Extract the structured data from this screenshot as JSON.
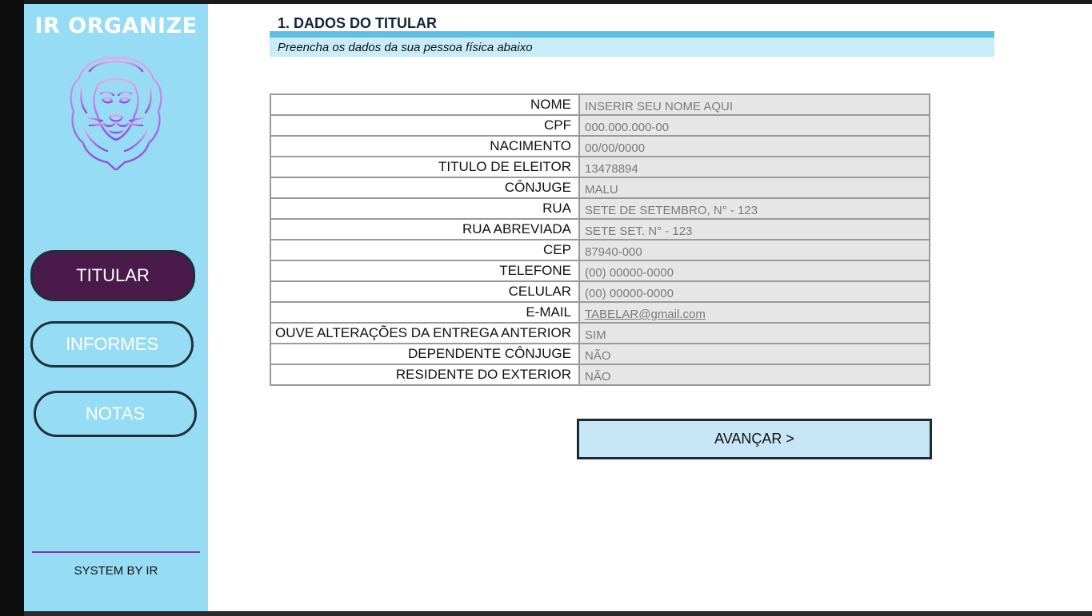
{
  "sidebar": {
    "brand": "IR ORGANIZE",
    "nav": [
      {
        "label": "TITULAR",
        "active": true
      },
      {
        "label": "INFORMES",
        "active": false
      },
      {
        "label": "NOTAS",
        "active": false
      }
    ],
    "footer": "SYSTEM BY IR"
  },
  "header": {
    "title": "1. DADOS DO TITULAR",
    "subtitle": "Preencha os dados da sua pessoa física abaixo"
  },
  "form": {
    "rows": [
      {
        "label": "NOME",
        "value": "INSERIR SEU NOME AQUI"
      },
      {
        "label": "CPF",
        "value": "000.000.000-00"
      },
      {
        "label": "NACIMENTO",
        "value": "00/00/0000"
      },
      {
        "label": "TITULO DE ELEITOR",
        "value": "13478894"
      },
      {
        "label": "CÔNJUGE",
        "value": "MALU"
      },
      {
        "label": "RUA",
        "value": "SETE DE SETEMBRO, N° - 123"
      },
      {
        "label": "RUA ABREVIADA",
        "value": "SETE SET. N° - 123"
      },
      {
        "label": "CEP",
        "value": "87940-000"
      },
      {
        "label": "TELEFONE",
        "value": "(00) 00000-0000"
      },
      {
        "label": "CELULAR",
        "value": "(00) 00000-0000"
      },
      {
        "label": "E-MAIL",
        "value": "TABELAR@gmail.com"
      },
      {
        "label": "OUVE ALTERAÇÕES DA ENTREGA ANTERIOR",
        "value": "SIM"
      },
      {
        "label": "DEPENDENTE CÔNJUGE",
        "value": "NÃO"
      },
      {
        "label": "RESIDENTE DO EXTERIOR",
        "value": "NÃO"
      }
    ],
    "next_label": "AVANÇAR >"
  },
  "colors": {
    "sidebar_bg": "#97dcf5",
    "active_nav": "#4a1a4a",
    "title_bar": "#5ec0e4",
    "subtitle_bar": "#c9ecfb",
    "input_bg": "#e6e6e6",
    "button_bg": "#c7e6f5"
  },
  "icons": {
    "logo": "lion-head-icon"
  }
}
